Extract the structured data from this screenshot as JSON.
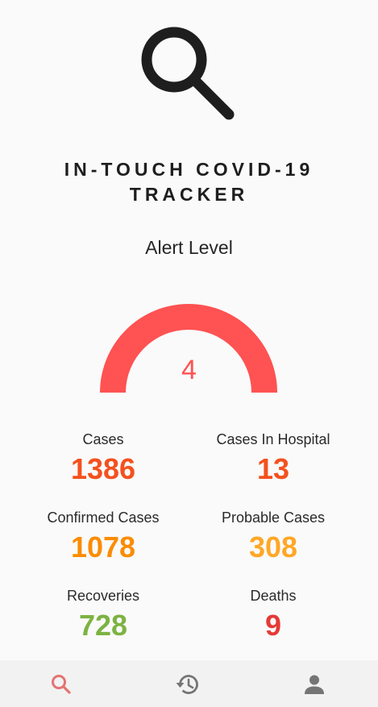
{
  "app": {
    "title_line1": "IN-TOUCH COVID-19",
    "title_line2": "TRACKER",
    "logo_icon": "search-icon"
  },
  "alert": {
    "label": "Alert Level",
    "value": "4",
    "level": 4,
    "max_level": 4,
    "color": "#ff5252"
  },
  "stats": {
    "cases": {
      "label": "Cases",
      "value": "1386",
      "color": "#f4511e"
    },
    "hospital": {
      "label": "Cases In Hospital",
      "value": "13",
      "color": "#f4511e"
    },
    "confirmed": {
      "label": "Confirmed Cases",
      "value": "1078",
      "color": "#fb8c00"
    },
    "probable": {
      "label": "Probable Cases",
      "value": "308",
      "color": "#ffa726"
    },
    "recoveries": {
      "label": "Recoveries",
      "value": "728",
      "color": "#7cb342"
    },
    "deaths": {
      "label": "Deaths",
      "value": "9",
      "color": "#e53935"
    }
  },
  "nav": {
    "items": [
      {
        "icon": "search-icon",
        "active": true,
        "color": "#e57373"
      },
      {
        "icon": "history-icon",
        "active": false,
        "color": "#757575"
      },
      {
        "icon": "person-icon",
        "active": false,
        "color": "#757575"
      }
    ]
  }
}
